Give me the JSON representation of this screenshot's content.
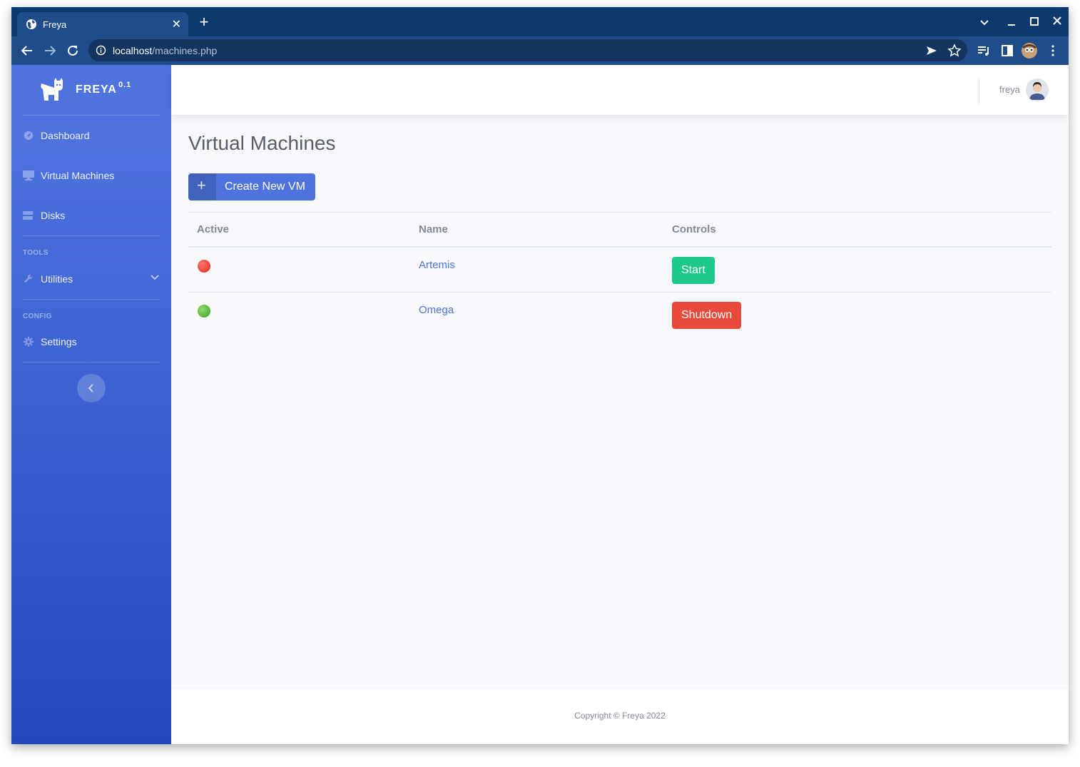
{
  "browser": {
    "tab_title": "Freya",
    "tab_close": "✕",
    "new_tab": "+",
    "url_host": "localhost",
    "url_path": "/machines.php"
  },
  "sidebar": {
    "brand_name": "FREYA",
    "brand_version": "0.1",
    "items": [
      {
        "label": "Dashboard",
        "icon": "dashboard-icon"
      },
      {
        "label": "Virtual Machines",
        "icon": "desktop-icon"
      },
      {
        "label": "Disks",
        "icon": "hdd-icon"
      }
    ],
    "tools_heading": "TOOLS",
    "utilities_label": "Utilities",
    "config_heading": "CONFIG",
    "settings_label": "Settings"
  },
  "topbar": {
    "user_name": "freya"
  },
  "main": {
    "page_title": "Virtual Machines",
    "create_button_label": "Create New VM",
    "table": {
      "headers": [
        "Active",
        "Name",
        "Controls"
      ],
      "rows": [
        {
          "active": "off",
          "name": "Artemis",
          "control": "Start",
          "control_color": "#1cc88a",
          "status_color": "#e74a3b"
        },
        {
          "active": "on",
          "name": "Omega",
          "control": "Shutdown",
          "control_color": "#e74a3b",
          "status_color": "#5cb85c"
        }
      ]
    }
  },
  "footer": {
    "copyright": "Copyright © Freya 2022"
  },
  "colors": {
    "primary": "#4e73df",
    "success": "#1cc88a",
    "danger": "#e74a3b"
  }
}
